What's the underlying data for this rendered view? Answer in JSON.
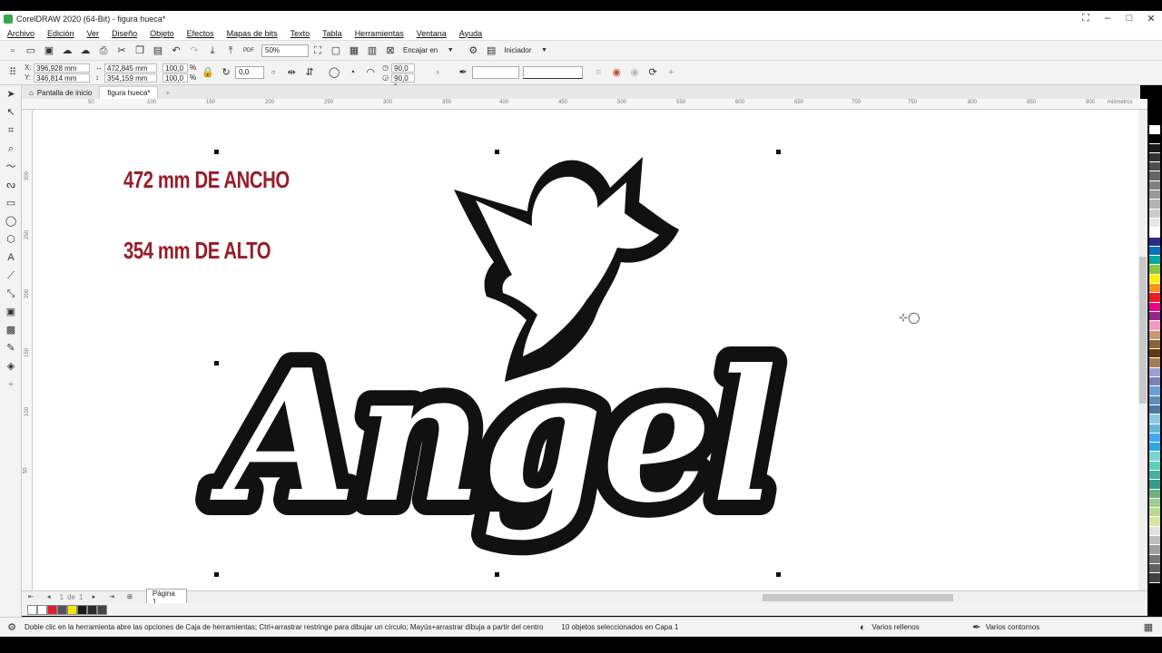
{
  "app": {
    "title": "CorelDRAW 2020 (64-Bit) - figura hueca*",
    "window_controls": [
      "⛶",
      "–",
      "□",
      "✕"
    ]
  },
  "menu": [
    "Archivo",
    "Edición",
    "Ver",
    "Diseño",
    "Objeto",
    "Efectos",
    "Mapas de bits",
    "Texto",
    "Tabla",
    "Herramientas",
    "Ventana",
    "Ayuda"
  ],
  "standard_toolbar": {
    "zoom": "50%",
    "snap_label": "Encajar en",
    "launcher_label": "Iniciador"
  },
  "property_bar": {
    "x": "396,928 mm",
    "y": "346,814 mm",
    "width": "472,845 mm",
    "height": "354,159 mm",
    "scale_x": "100,0",
    "scale_y": "100,0",
    "percent": "%",
    "rotation": "0,0",
    "angle1": "90,0 °",
    "angle2": "90,0 °"
  },
  "tabs": {
    "home": "Pantalla de inicio",
    "doc": "figura hueca*",
    "add": "+"
  },
  "ruler": {
    "h_ticks": [
      "50",
      "100",
      "150",
      "200",
      "250",
      "300",
      "350",
      "400",
      "450",
      "500",
      "550",
      "600",
      "650",
      "700",
      "750",
      "800",
      "850",
      "900"
    ],
    "unit": "milímetros",
    "v_ticks": [
      "300",
      "250",
      "200",
      "150",
      "100",
      "50"
    ]
  },
  "canvas": {
    "annotation_width": "472 mm DE ANCHO",
    "annotation_height": "354 mm DE ALTO",
    "artwork_text": "Angel"
  },
  "page_nav": {
    "current": "1",
    "of": "de",
    "total": "1",
    "page_tab": "Página 1"
  },
  "status": {
    "hint": "Doble clic en la herramienta abre las opciones de Caja de herramientas; Ctrl+arrastrar restringe para dibujar un círculo; Mayús+arrastrar dibuja a partir del centro",
    "selection": "10 objetos seleccionados en Capa 1",
    "fill": "Varios rellenos",
    "outline": "Varios contornos"
  },
  "colors": {
    "annotation": "#9a1b2a",
    "palette": [
      "#ffffff",
      "#000000",
      "#1a1a1a",
      "#333333",
      "#4d4d4d",
      "#666666",
      "#808080",
      "#999999",
      "#b3b3b3",
      "#cccccc",
      "#e6e6e6",
      "#ffffff",
      "#2e2a8c",
      "#0071bc",
      "#00a99d",
      "#8cc63f",
      "#fff200",
      "#f7941d",
      "#ed1c24",
      "#ec008c",
      "#92278f",
      "#f49ac1",
      "#c69c6d",
      "#8c6239",
      "#603813",
      "#a67c52",
      "#9e9ed1",
      "#7f7fb8",
      "#6a9fd6",
      "#5b8fb9",
      "#4a7aa0",
      "#8ec7df",
      "#66b8d6",
      "#3fa9f5",
      "#29abe2",
      "#7fd1d6",
      "#5ccfb6",
      "#3fb39b",
      "#2e9e86",
      "#6fb07f",
      "#9bcf8f",
      "#b8d98f",
      "#d6e6a0",
      "#e0e0e0",
      "#bdbdbd",
      "#9e9e9e",
      "#757575",
      "#616161",
      "#424242"
    ],
    "doc_palette": [
      "#ffffff",
      "#ffffff",
      "#e0202a",
      "#555555",
      "#f5e400",
      "#1a1a1a",
      "#2a2a2a",
      "#444444"
    ]
  }
}
